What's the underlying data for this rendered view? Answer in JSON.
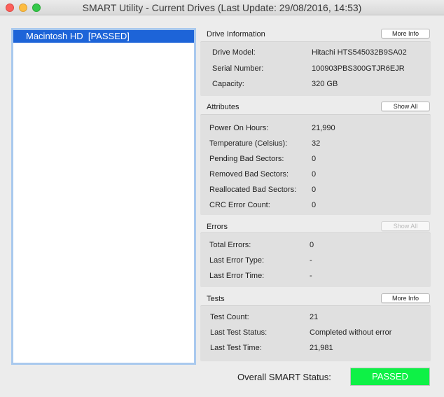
{
  "window": {
    "title": "SMART Utility - Current Drives (Last Update: 29/08/2016, 14:53)"
  },
  "drives": [
    {
      "label": "Macintosh HD  [PASSED]"
    }
  ],
  "drive_info": {
    "title": "Drive Information",
    "button": "More Info",
    "rows": [
      {
        "label": "Drive Model:",
        "value": "Hitachi HTS545032B9SA02"
      },
      {
        "label": "Serial Number:",
        "value": "100903PBS300GTJR6EJR"
      },
      {
        "label": "Capacity:",
        "value": "320 GB"
      }
    ]
  },
  "attributes": {
    "title": "Attributes",
    "button": "Show All",
    "rows": [
      {
        "label": "Power On Hours:",
        "value": "21,990"
      },
      {
        "label": "Temperature (Celsius):",
        "value": "32"
      },
      {
        "label": "Pending Bad Sectors:",
        "value": "0"
      },
      {
        "label": "Removed Bad Sectors:",
        "value": "0"
      },
      {
        "label": "Reallocated Bad Sectors:",
        "value": "0"
      },
      {
        "label": "CRC Error Count:",
        "value": "0"
      }
    ]
  },
  "errors": {
    "title": "Errors",
    "button": "Show All",
    "rows": [
      {
        "label": "Total Errors:",
        "value": "0"
      },
      {
        "label": "Last Error Type:",
        "value": "-"
      },
      {
        "label": "Last Error Time:",
        "value": "-"
      }
    ]
  },
  "tests": {
    "title": "Tests",
    "button": "More Info",
    "rows": [
      {
        "label": "Test Count:",
        "value": "21"
      },
      {
        "label": "Last Test Status:",
        "value": "Completed without error"
      },
      {
        "label": "Last Test Time:",
        "value": "21,981"
      }
    ]
  },
  "overall": {
    "label": "Overall SMART Status:",
    "status": "PASSED",
    "status_color": "#0ef146"
  }
}
